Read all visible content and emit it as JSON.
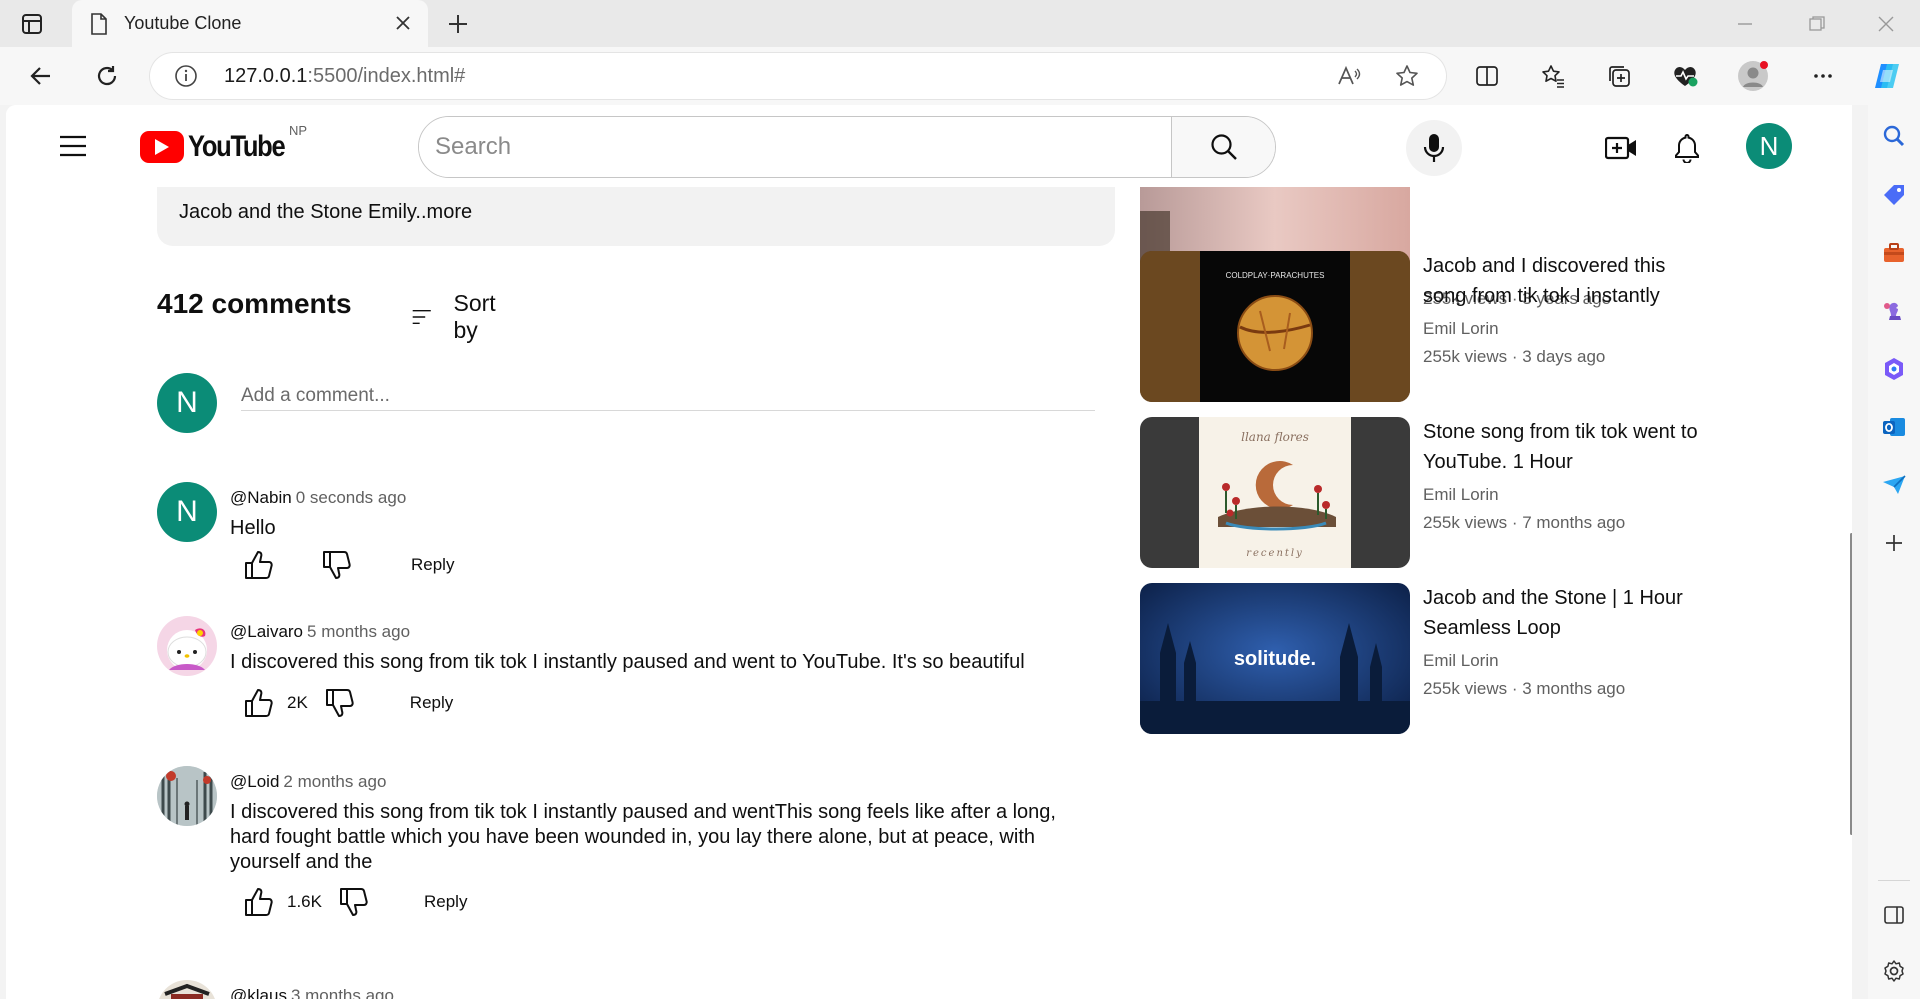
{
  "browser": {
    "tab_title": "Youtube Clone",
    "url_host": "127.0.0.1",
    "url_rest": ":5500/index.html#"
  },
  "header": {
    "logo_text": "YouTube",
    "region": "NP",
    "search_placeholder": "Search",
    "avatar_letter": "N"
  },
  "description": {
    "text": "Jacob and the Stone Emily..more"
  },
  "comments": {
    "count_label": "412 comments",
    "sort_label": "Sort by",
    "add_placeholder": "Add a comment...",
    "avatar_letter": "N",
    "items": [
      {
        "user": "@Nabin",
        "time": "0 seconds ago",
        "text": "Hello",
        "likes": "",
        "reply": "Reply",
        "avatar": "N"
      },
      {
        "user": "@Laivaro",
        "time": "5 months ago",
        "text": "I discovered this song from tik tok I instantly paused and went to YouTube. It's so beautiful",
        "likes": "2K",
        "reply": "Reply"
      },
      {
        "user": "@Loid",
        "time": "2 months ago",
        "text": "I discovered this song from tik tok I instantly paused and wentThis song feels like after a long, hard fought battle which you have been wounded in, you lay there alone, but at peace, with yourself and the",
        "likes": "1.6K",
        "reply": "Reply"
      },
      {
        "user": "@klaus",
        "time": "3 months ago"
      }
    ]
  },
  "recommendations": [
    {
      "title": "",
      "channel": "",
      "stats": "255k views · 3 years ago"
    },
    {
      "title": "Jacob and I discovered this song from tik tok I instantly",
      "channel": "Emil Lorin",
      "stats": "255k views · 3 days ago",
      "thumb_text": "COLDPLAY·PARACHUTES"
    },
    {
      "title": "Stone song from tik tok went to YouTube. 1 Hour",
      "channel": "Emil Lorin",
      "stats": "255k views · 7 months ago",
      "thumb_text_top": "llana flores",
      "thumb_text_bottom": "recently"
    },
    {
      "title": "Jacob and the Stone | 1 Hour Seamless Loop",
      "channel": "Emil Lorin",
      "stats": "255k views · 3 months ago",
      "thumb_text": "solitude."
    }
  ]
}
